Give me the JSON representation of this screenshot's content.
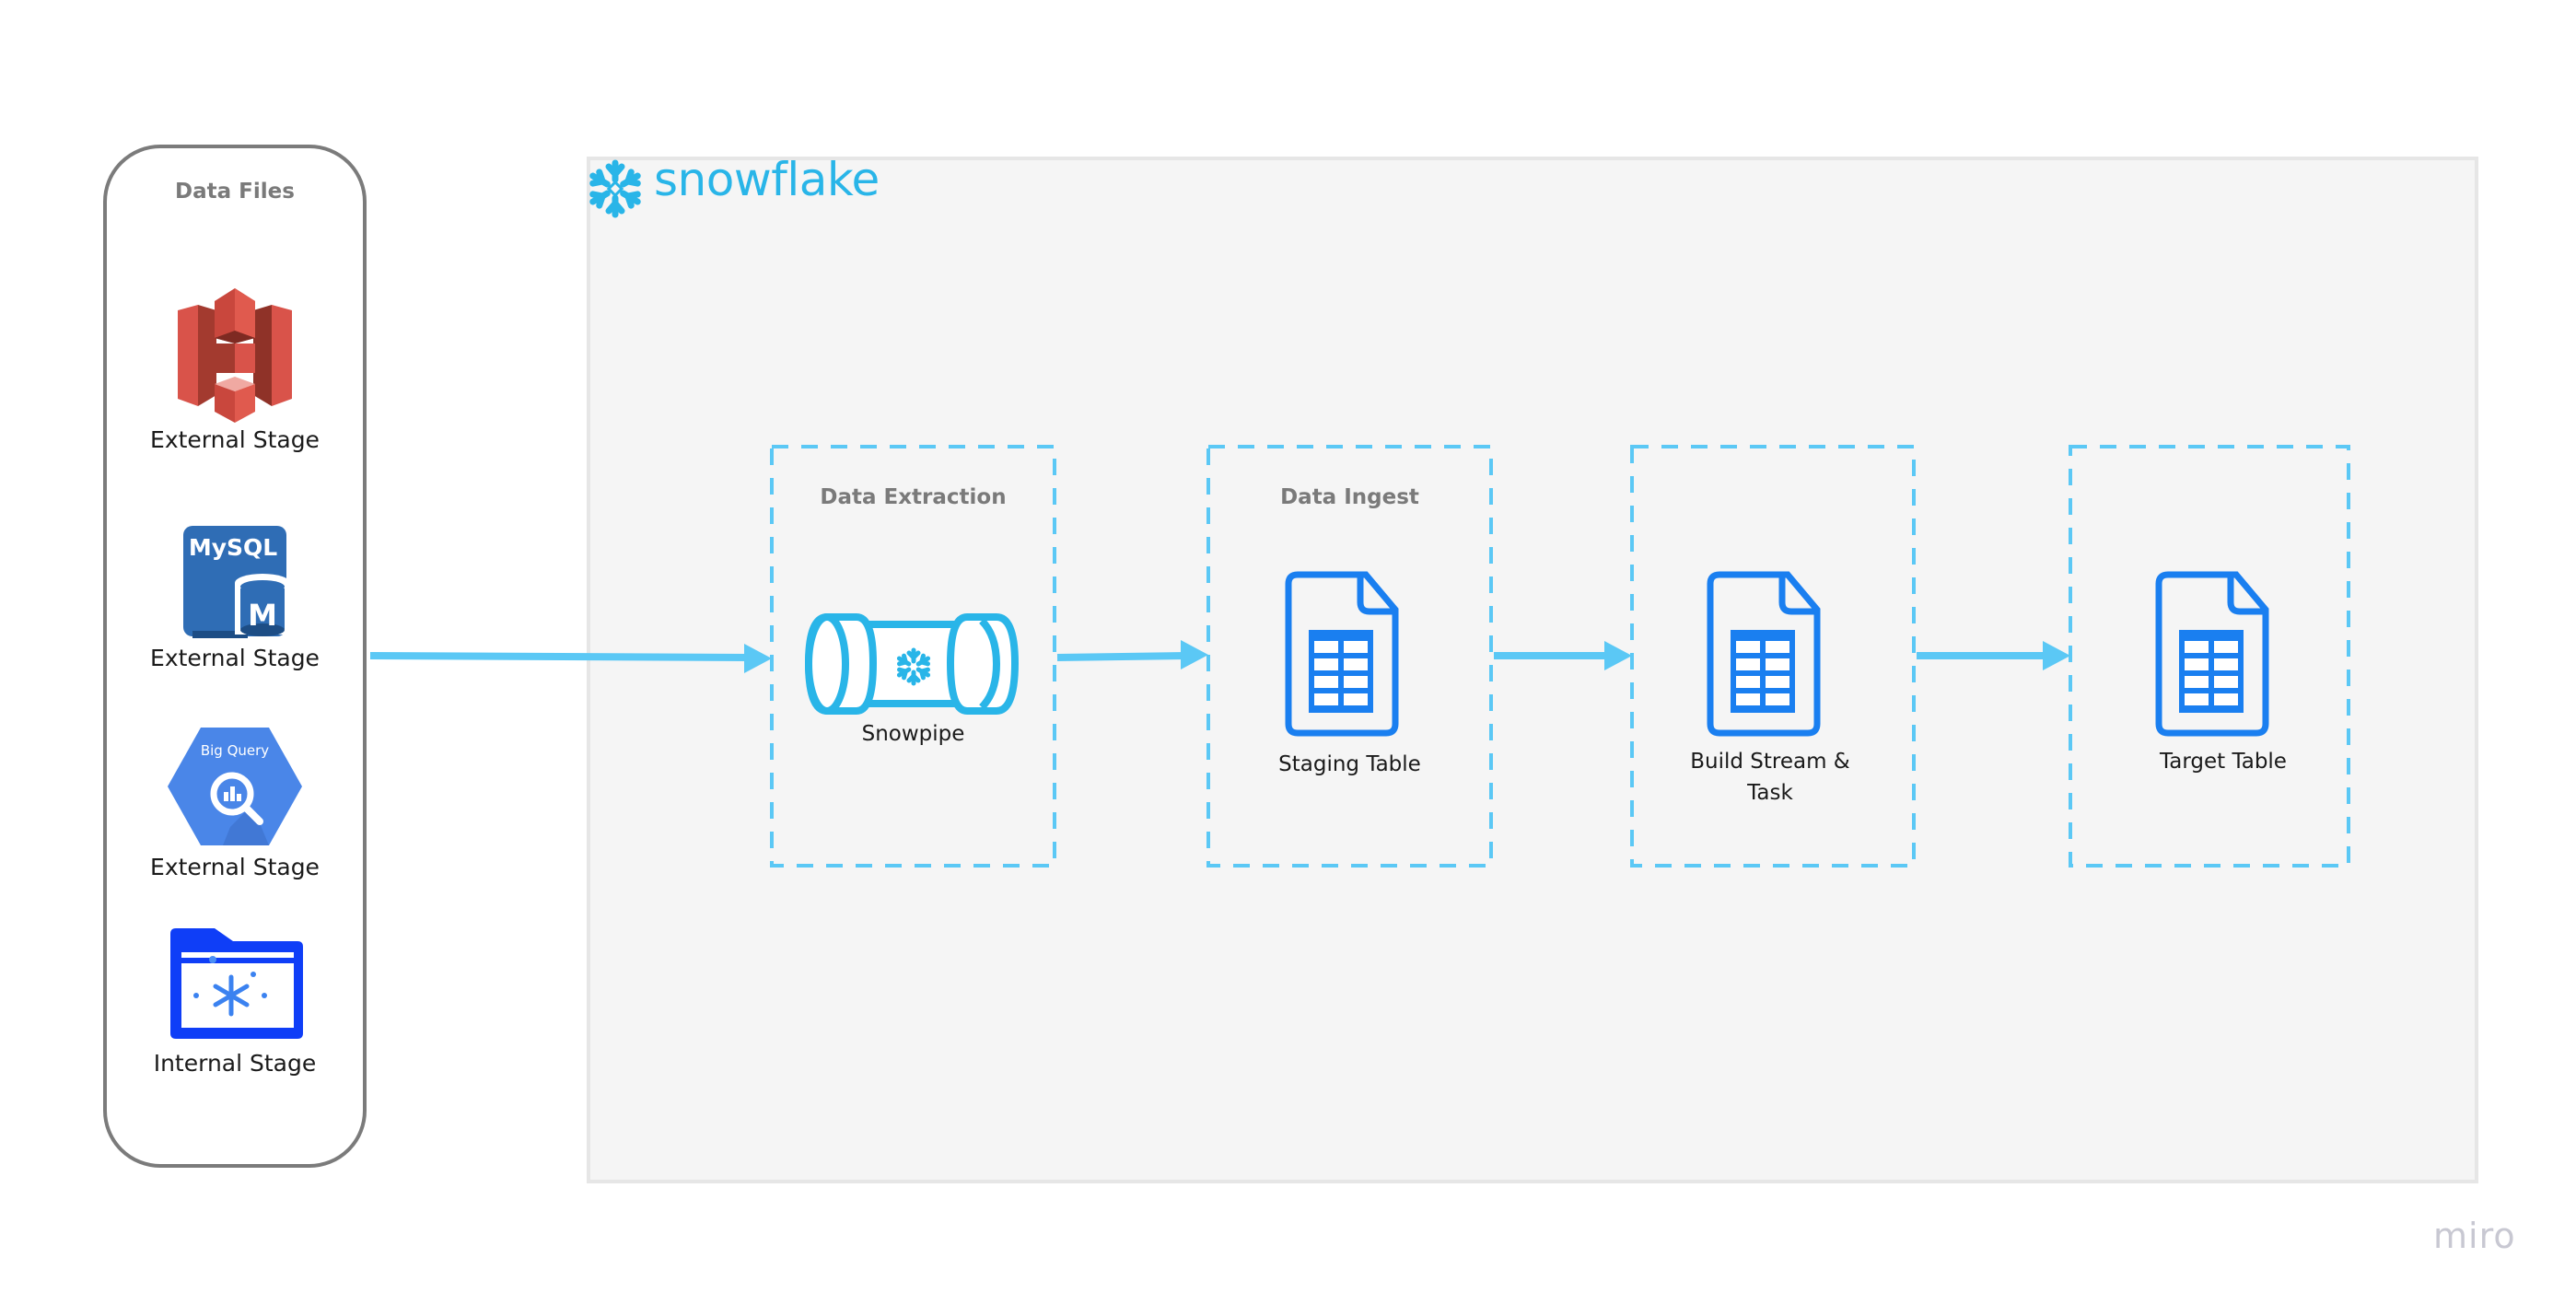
{
  "diagram": {
    "source_group": {
      "title": "Data Files",
      "sources": [
        {
          "icon": "aws-s3-icon",
          "label": "External Stage"
        },
        {
          "icon": "mysql-icon",
          "label": "External Stage",
          "icon_text": "MySQL",
          "badge_text": "M"
        },
        {
          "icon": "bigquery-icon",
          "label": "External Stage",
          "icon_text": "Big Query"
        },
        {
          "icon": "snowflake-folder-icon",
          "label": "Internal Stage"
        }
      ]
    },
    "platform": {
      "logo_text": "snowflake",
      "brand_color": "#29b5e8"
    },
    "stages": [
      {
        "title": "Data Extraction",
        "node": {
          "icon": "snowpipe-icon",
          "label": "Snowpipe"
        }
      },
      {
        "title": "Data Ingest",
        "node": {
          "icon": "table-document-icon",
          "label": "Staging Table"
        }
      },
      {
        "title": "",
        "node": {
          "icon": "table-document-icon",
          "label": "Build Stream & Task"
        }
      },
      {
        "title": "",
        "node": {
          "icon": "table-document-icon",
          "label": "Target Table"
        }
      }
    ],
    "edges": [
      {
        "from": "Data Files",
        "to": "Data Extraction"
      },
      {
        "from": "Data Extraction",
        "to": "Data Ingest"
      },
      {
        "from": "Data Ingest",
        "to": "Build Stream & Task"
      },
      {
        "from": "Build Stream & Task",
        "to": "Target Table"
      }
    ],
    "colors": {
      "arrow": "#5bc8f5",
      "dashed_border": "#5bc8f5",
      "table_icon": "#1a7ff0",
      "group_border": "#7b7b7b",
      "container_bg": "#f5f5f5"
    }
  },
  "watermark": {
    "text": "miro"
  }
}
